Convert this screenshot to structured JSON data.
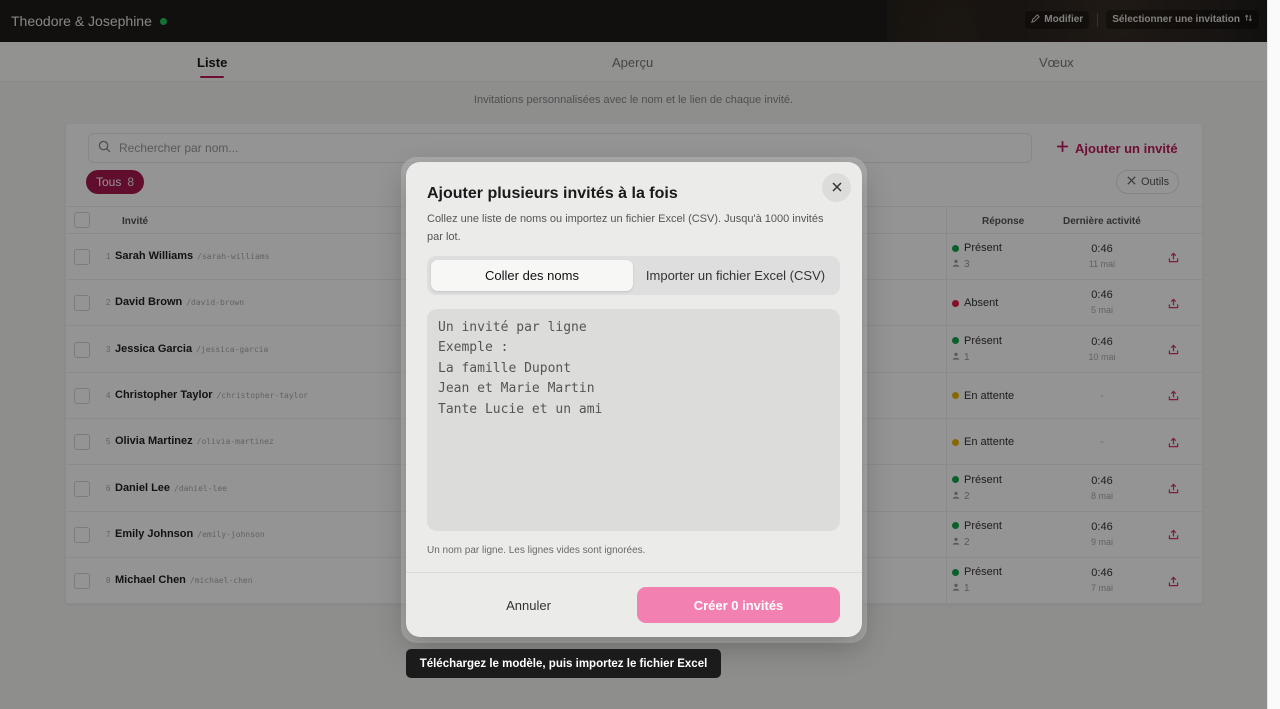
{
  "header": {
    "couple_name": "Theodore & Josephine",
    "edit_label": "Modifier",
    "select_invitation_label": "Sélectionner une invitation"
  },
  "tabs": [
    {
      "label": "Liste",
      "active": true
    },
    {
      "label": "Aperçu",
      "active": false
    },
    {
      "label": "Vœux",
      "active": false
    }
  ],
  "subtitle": "Invitations personnalisées avec le nom et le lien de chaque invité.",
  "toolbar": {
    "search_placeholder": "Rechercher par nom...",
    "add_guest_label": "Ajouter un invité",
    "filter_label": "Tous",
    "filter_count": "8",
    "tools_label": "Outils"
  },
  "table": {
    "col_guest": "Invité",
    "col_response": "Réponse",
    "col_activity": "Dernière activité",
    "rows": [
      {
        "num": "1",
        "name": "Sarah Williams",
        "slug": "/sarah-williams",
        "status": "Présent",
        "status_color": "#16a34a",
        "count": "3",
        "time": "0:46",
        "date": "11 mai"
      },
      {
        "num": "2",
        "name": "David Brown",
        "slug": "/david-brown",
        "status": "Absent",
        "status_color": "#e11d48",
        "count": "",
        "time": "0:46",
        "date": "5 mai"
      },
      {
        "num": "3",
        "name": "Jessica Garcia",
        "slug": "/jessica-garcia",
        "status": "Présent",
        "status_color": "#16a34a",
        "count": "1",
        "time": "0:46",
        "date": "10 mai"
      },
      {
        "num": "4",
        "name": "Christopher Taylor",
        "slug": "/christopher-taylor",
        "status": "En attente",
        "status_color": "#eab308",
        "count": "",
        "time": "",
        "date": "-"
      },
      {
        "num": "5",
        "name": "Olivia Martinez",
        "slug": "/olivia-martinez",
        "status": "En attente",
        "status_color": "#eab308",
        "count": "",
        "time": "",
        "date": "-"
      },
      {
        "num": "6",
        "name": "Daniel Lee",
        "slug": "/daniel-lee",
        "status": "Présent",
        "status_color": "#16a34a",
        "count": "2",
        "time": "0:46",
        "date": "8 mai"
      },
      {
        "num": "7",
        "name": "Emily Johnson",
        "slug": "/emily-johnson",
        "status": "Présent",
        "status_color": "#16a34a",
        "count": "2",
        "time": "0:46",
        "date": "9 mai"
      },
      {
        "num": "8",
        "name": "Michael Chen",
        "slug": "/michael-chen",
        "status": "Présent",
        "status_color": "#16a34a",
        "count": "1",
        "time": "0:46",
        "date": "7 mai"
      }
    ]
  },
  "modal": {
    "title": "Ajouter plusieurs invités à la fois",
    "description": "Collez une liste de noms ou importez un fichier Excel (CSV). Jusqu'à 1000 invités par lot.",
    "tab_paste": "Coller des noms",
    "tab_import": "Importer un fichier Excel (CSV)",
    "textarea_placeholder": "Un invité par ligne\nExemple :\nLa famille Dupont\nJean et Marie Martin\nTante Lucie et un ami",
    "hint": "Un nom par ligne. Les lignes vides sont ignorées.",
    "cancel_label": "Annuler",
    "create_label": "Créer 0 invités"
  },
  "tooltip": "Téléchargez le modèle, puis importez le fichier Excel",
  "colors": {
    "accent": "#c2185b",
    "create_button": "#f280b1"
  }
}
